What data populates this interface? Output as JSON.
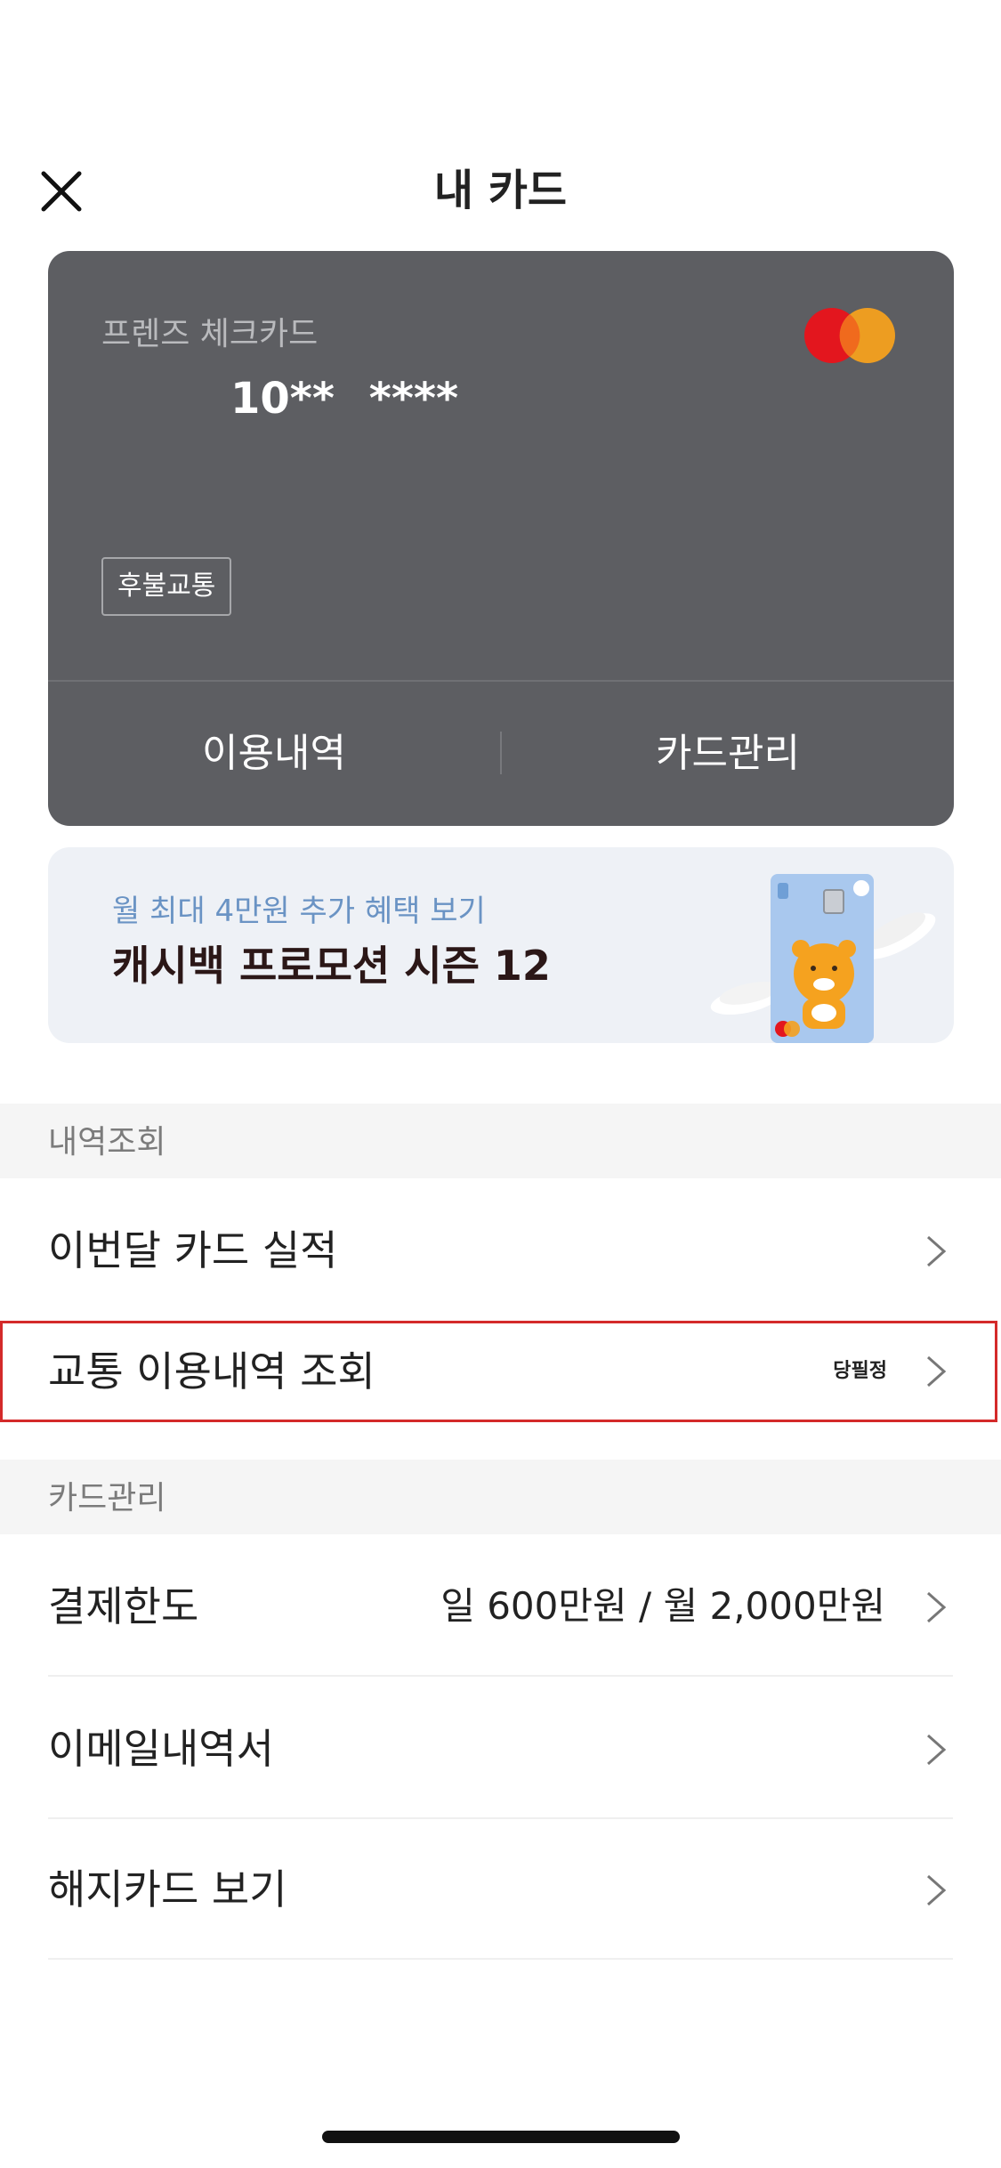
{
  "header": {
    "title": "내 카드",
    "close_icon": "close-icon"
  },
  "card": {
    "name": "프렌즈 체크카드",
    "number": "10** ****",
    "badge": "후불교통",
    "brand_icon": "mastercard-logo",
    "actions": [
      "이용내역",
      "카드관리"
    ],
    "color": "#5d5e62"
  },
  "promo": {
    "subtitle": "월 최대 4만원 추가 혜택 보기",
    "title": "캐시백 프로모션 시즌 12",
    "image": "character-card-illustration"
  },
  "sections": {
    "history": {
      "header": "내역조회",
      "items": [
        {
          "label": "이번달 카드 실적"
        },
        {
          "label": "교통 이용내역 조회",
          "tag": "당필정"
        }
      ]
    },
    "manage": {
      "header": "카드관리",
      "items": [
        {
          "label": "결제한도",
          "value": "일 600만원 / 월 2,000만원"
        },
        {
          "label": "이메일내역서"
        },
        {
          "label": "해지카드 보기"
        }
      ]
    }
  },
  "colors": {
    "highlight": "#d42a2a",
    "promo_subtitle": "#6a93c4",
    "section_bg": "#f5f5f5"
  }
}
